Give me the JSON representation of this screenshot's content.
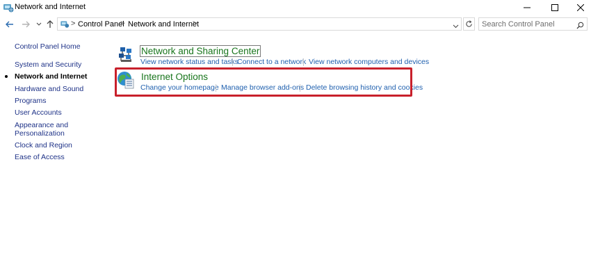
{
  "window": {
    "title": "Network and Internet",
    "controls": [
      "minimize",
      "maximize",
      "close"
    ]
  },
  "nav": {
    "back_icon": "arrow-left-icon",
    "forward_icon": "arrow-right-icon",
    "recent_icon": "chevron-down-icon",
    "up_icon": "arrow-up-icon"
  },
  "address": {
    "breadcrumbs": [
      "Control Panel",
      "Network and Internet"
    ],
    "separator": ">",
    "dropdown_icon": "chevron-down-icon",
    "refresh_icon": "refresh-icon"
  },
  "search": {
    "placeholder": "Search Control Panel",
    "value": "",
    "icon": "search-icon"
  },
  "sidebar": {
    "items": [
      {
        "label": "Control Panel Home"
      },
      {
        "label": "System and Security"
      },
      {
        "label": "Network and Internet",
        "active": true
      },
      {
        "label": "Hardware and Sound"
      },
      {
        "label": "Programs"
      },
      {
        "label": "User Accounts"
      },
      {
        "label": "Appearance and"
      },
      {
        "label": "Personalization"
      },
      {
        "label": "Clock and Region"
      },
      {
        "label": "Ease of Access"
      }
    ]
  },
  "categories": [
    {
      "title": "Network and Sharing Center",
      "icon": "network-sharing-center-icon",
      "links": [
        "View network status and tasks",
        "Connect to a network",
        "View network computers and devices"
      ]
    },
    {
      "title": "Internet Options",
      "icon": "internet-options-globe-icon",
      "links": [
        "Change your homepage",
        "Manage browser add-ons",
        "Delete browsing history and cookies"
      ],
      "highlighted": true
    }
  ],
  "colors": {
    "category_title": "#18751c",
    "task_link": "#1e5fae",
    "highlight_border": "#c8202b"
  }
}
